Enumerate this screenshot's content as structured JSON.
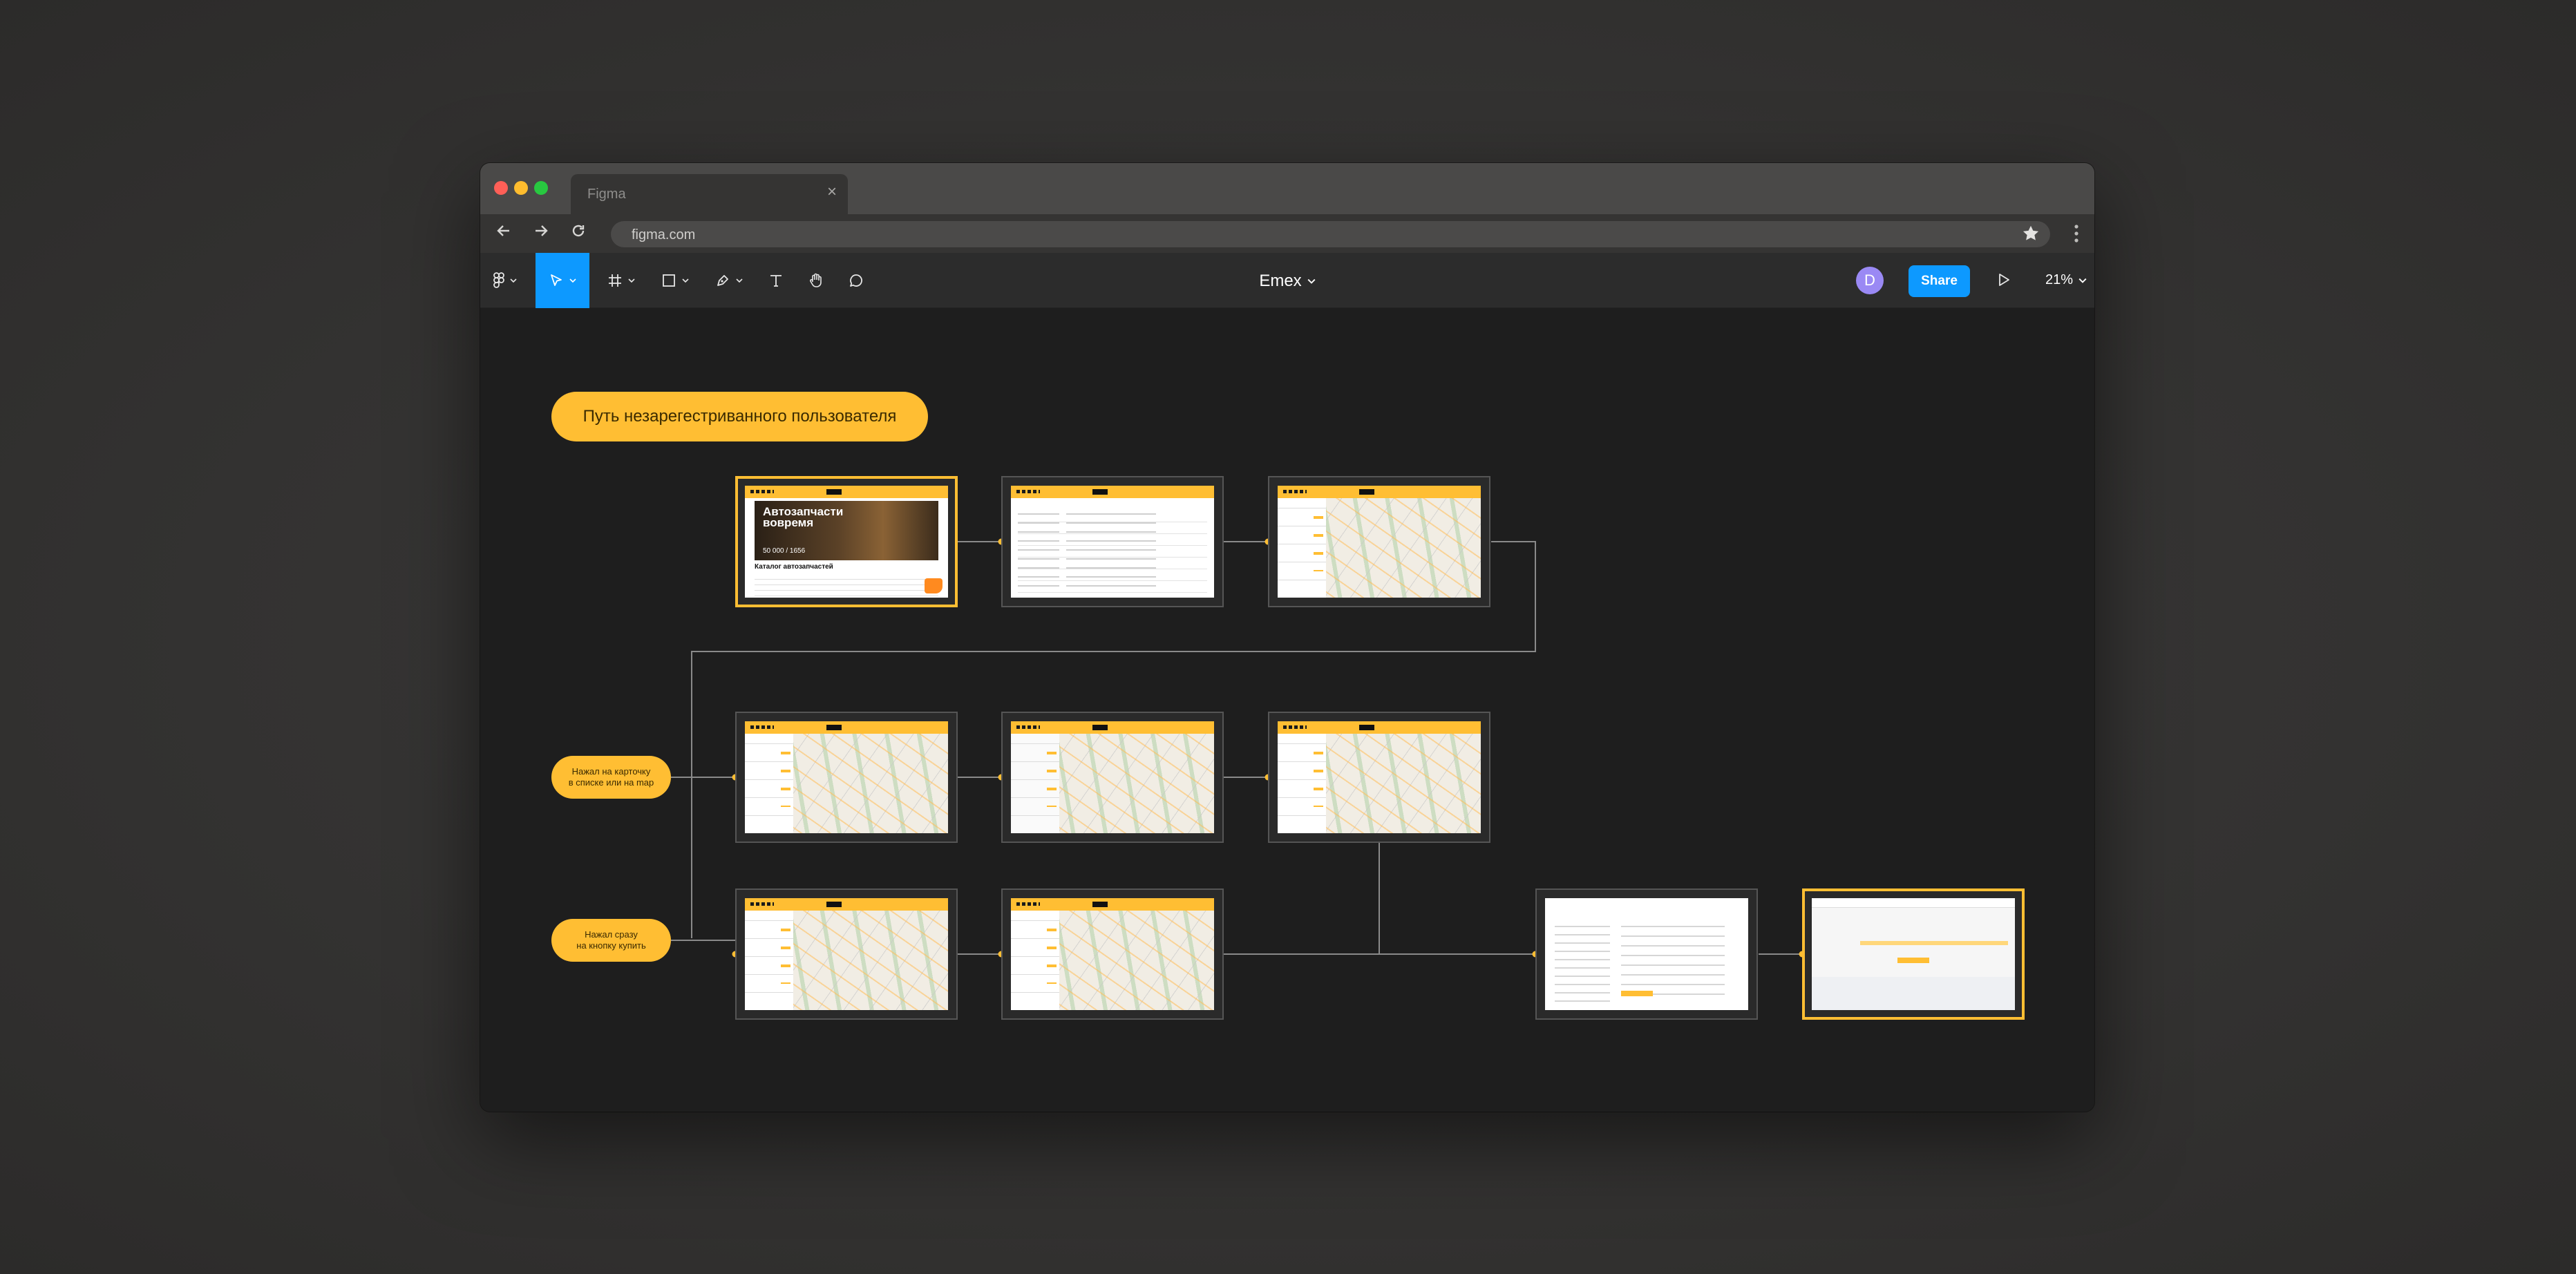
{
  "browser": {
    "tab_title": "Figma",
    "tab_close_icon": "×",
    "url": "figma.com"
  },
  "figma": {
    "document_title": "Emex",
    "avatar_letter": "D",
    "share_label": "Share",
    "zoom": "21%"
  },
  "canvas": {
    "section_title": "Путь незарегестриванного пользователя",
    "branch_card_label": [
      "Нажал на карточку",
      "в списке или на map"
    ],
    "branch_buy_label": [
      "Нажал сразу",
      "на кнопку купить"
    ],
    "frames": {
      "home": {
        "hero_line1": "Автозапчасти",
        "hero_line2": "вовремя",
        "hero_stat": "50 000 / 1656",
        "catalog_title": "Каталог автозапчастей"
      }
    }
  },
  "colors": {
    "accent_yellow": "#ffbe33",
    "figma_blue": "#0d99ff",
    "canvas_bg": "#1e1e1e",
    "avatar": "#9a89f4"
  },
  "icons": {
    "figma_menu": "figma-logo-icon",
    "move": "cursor-arrow-icon",
    "frame": "hash-frame-icon",
    "rectangle": "rectangle-icon",
    "pen": "pen-icon",
    "text": "text-t-icon",
    "hand": "hand-icon",
    "comment": "speech-bubble-icon",
    "present": "play-icon"
  }
}
